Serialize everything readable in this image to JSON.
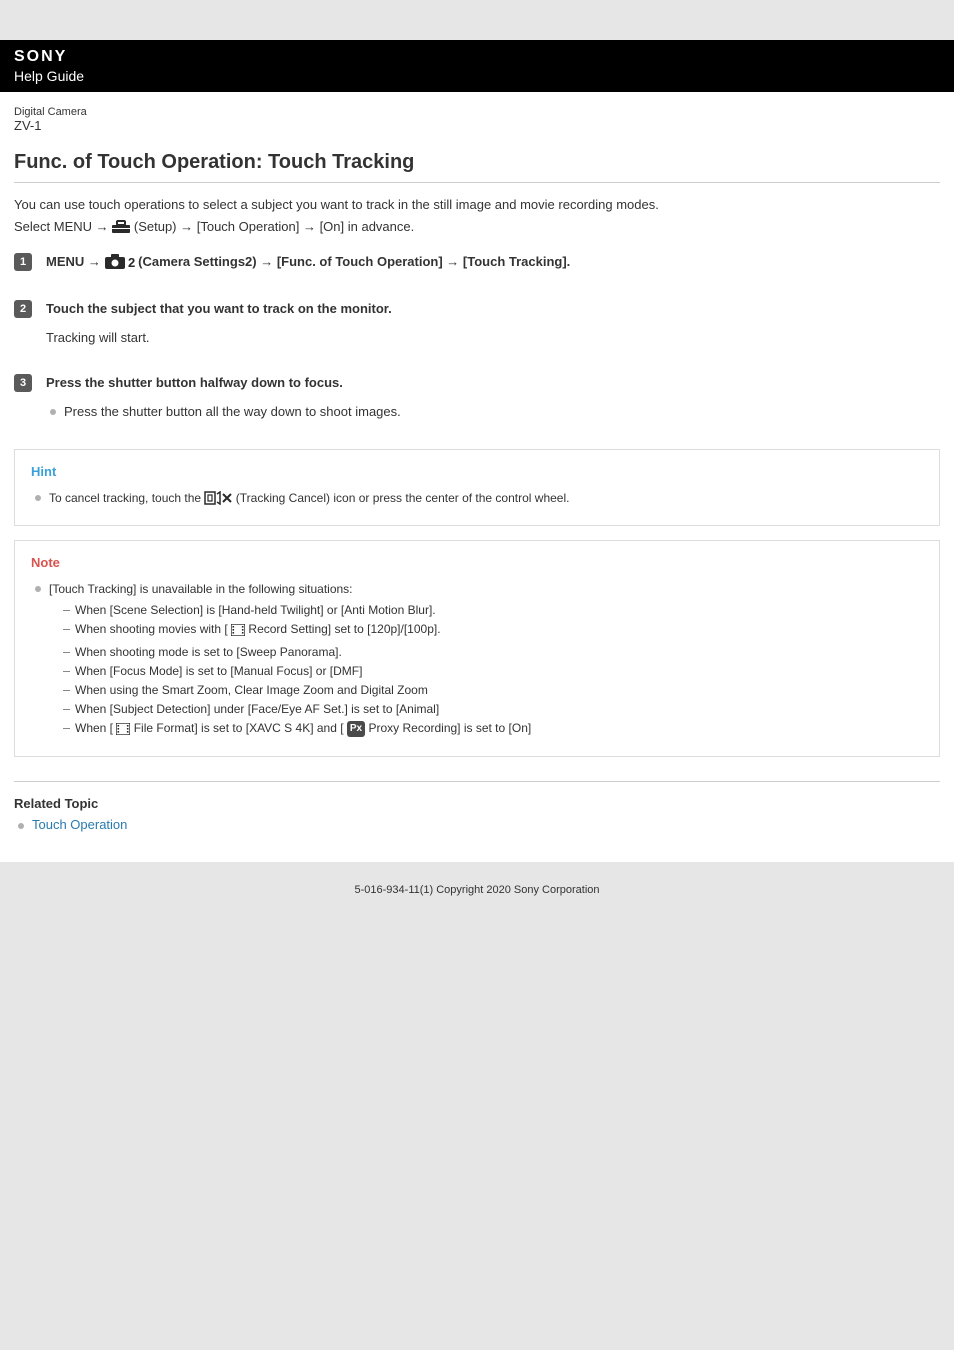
{
  "header": {
    "brand": "SONY",
    "guide_label": "Help Guide",
    "product_line": "Digital Camera",
    "model": "ZV-1"
  },
  "title": "Func. of Touch Operation: Touch Tracking",
  "intro": {
    "line1": "You can use touch operations to select a subject you want to track in the still image and movie recording modes.",
    "line2_pre": "Select MENU → ",
    "line2_setup": " (Setup) → [Touch Operation] → [On] in advance."
  },
  "steps": [
    {
      "num": "1",
      "title_pre": "MENU → ",
      "title_post": " (Camera Settings2) → [Func. of Touch Operation] → [Touch Tracking]."
    },
    {
      "num": "2",
      "title": "Touch the subject that you want to track on the monitor.",
      "body": "Tracking will start."
    },
    {
      "num": "3",
      "title": "Press the shutter button halfway down to focus.",
      "bullets": [
        "Press the shutter button all the way down to shoot images."
      ]
    }
  ],
  "hint": {
    "label": "Hint",
    "item_pre": "To cancel tracking, touch the ",
    "item_post": " (Tracking Cancel) icon or press the center of the control wheel."
  },
  "note": {
    "label": "Note",
    "lead": "[Touch Tracking] is unavailable in the following situations:",
    "items": [
      {
        "text": "When [Scene Selection] is [Hand-held Twilight] or [Anti Motion Blur]."
      },
      {
        "pre": "When shooting movies with [ ",
        "mid": " Record Setting] set to [120p]/[100p]."
      },
      {
        "text": "When shooting mode is set to [Sweep Panorama]."
      },
      {
        "text": "When [Focus Mode] is set to [Manual Focus] or [DMF]"
      },
      {
        "text": "When using the Smart Zoom, Clear Image Zoom and Digital Zoom"
      },
      {
        "text": "When [Subject Detection] under [Face/Eye AF Set.] is set to [Animal]"
      },
      {
        "pre": "When [ ",
        "mid": " File Format] is set to [XAVC S 4K] and [ ",
        "px": "Px",
        "post": " Proxy Recording] is set to [On]"
      }
    ]
  },
  "related": {
    "label": "Related Topic",
    "items": [
      "Touch Operation"
    ]
  },
  "footer": "5-016-934-11(1) Copyright 2020 Sony Corporation"
}
